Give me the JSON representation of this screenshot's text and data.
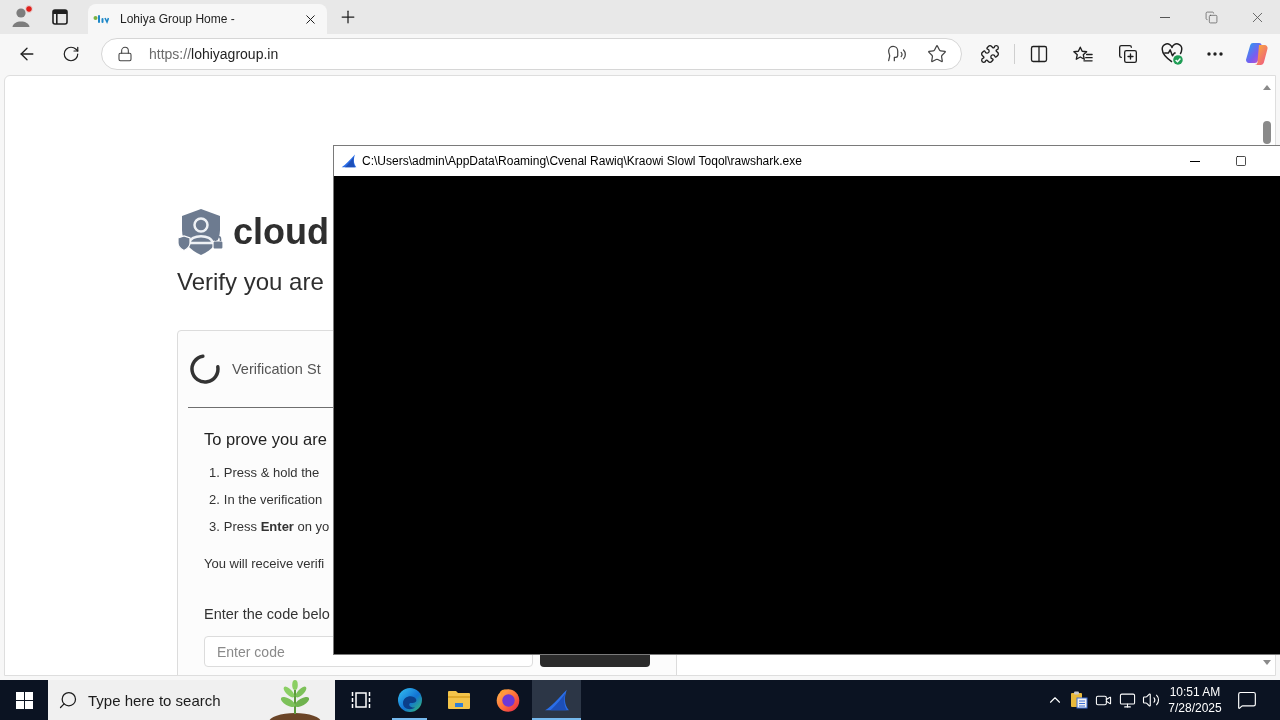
{
  "browser": {
    "tabs": [
      {
        "title": "Lohiya Group Home -",
        "selected": true
      }
    ],
    "address_bar": {
      "scheme": "https://",
      "host": "lohiyagroup.in"
    }
  },
  "page": {
    "logo_text": "cloud",
    "heading": "Verify you are",
    "card": {
      "status": "Verification St",
      "title": "To prove you are",
      "steps": [
        {
          "number": "1.",
          "text": "Press & hold the"
        },
        {
          "number": "2.",
          "text": "In the verification"
        },
        {
          "number": "3.",
          "text": "Press **Enter** on yo"
        }
      ],
      "note": "You will receive verifi",
      "code_label": "Enter the code belo",
      "code_field": {
        "placeholder": "Enter code"
      }
    }
  },
  "console_window": {
    "title": "C:\\Users\\admin\\AppData\\Roaming\\Cvenal Rawiq\\Kraowi Slowl Toqol\\rawshark.exe"
  },
  "taskbar": {
    "search": {
      "placeholder": "Type here to search"
    },
    "apps": [
      {
        "kind": "edge",
        "running": true,
        "selected": false
      },
      {
        "kind": "folder",
        "running": false,
        "selected": false
      },
      {
        "kind": "firefox",
        "running": false,
        "selected": false
      },
      {
        "kind": "shark",
        "running": true,
        "selected": true
      }
    ],
    "clock": {
      "time": "10:51 AM",
      "date": "7/28/2025"
    }
  }
}
